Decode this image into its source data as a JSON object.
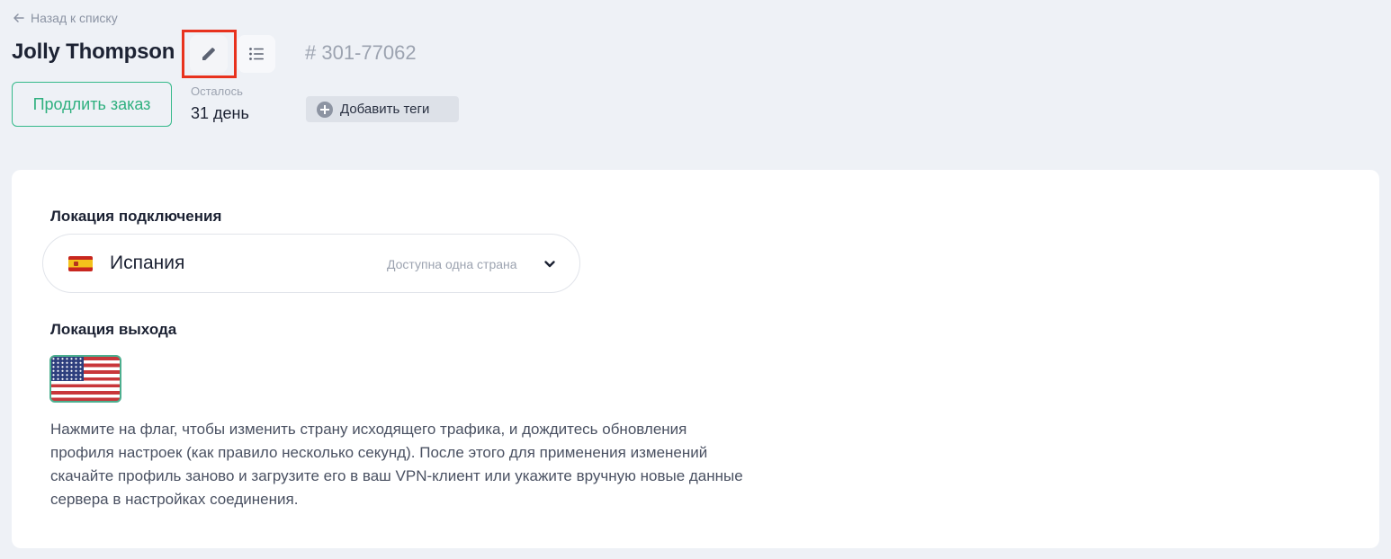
{
  "header": {
    "back_link": "Назад к списку",
    "title": "Jolly Thompson",
    "order_id": "# 301-77062",
    "edit_button_icon": "pencil-icon",
    "list_button_icon": "list-icon",
    "extend_button": "Продлить заказ",
    "remaining_label": "Осталось",
    "remaining_value": "31 день",
    "add_tags_button": "Добавить теги"
  },
  "connection": {
    "label": "Локация подключения",
    "selected_country": "Испания",
    "hint": "Доступна одна страна",
    "flag": "spain-flag-icon"
  },
  "exit": {
    "label": "Локация выхода",
    "flag": "usa-flag-icon",
    "description": "Нажмите на флаг, чтобы изменить страну исходящего трафика, и дождитесь обновления профиля настроек (как правило несколько секунд). После этого для применения изменений скачайте профиль заново и загрузите его в ваш VPN-клиент или укажите вручную новые данные сервера в настройках соединения."
  },
  "colors": {
    "accent_green": "#2fb07f",
    "highlight_red": "#e8321e",
    "background": "#eef1f6"
  }
}
